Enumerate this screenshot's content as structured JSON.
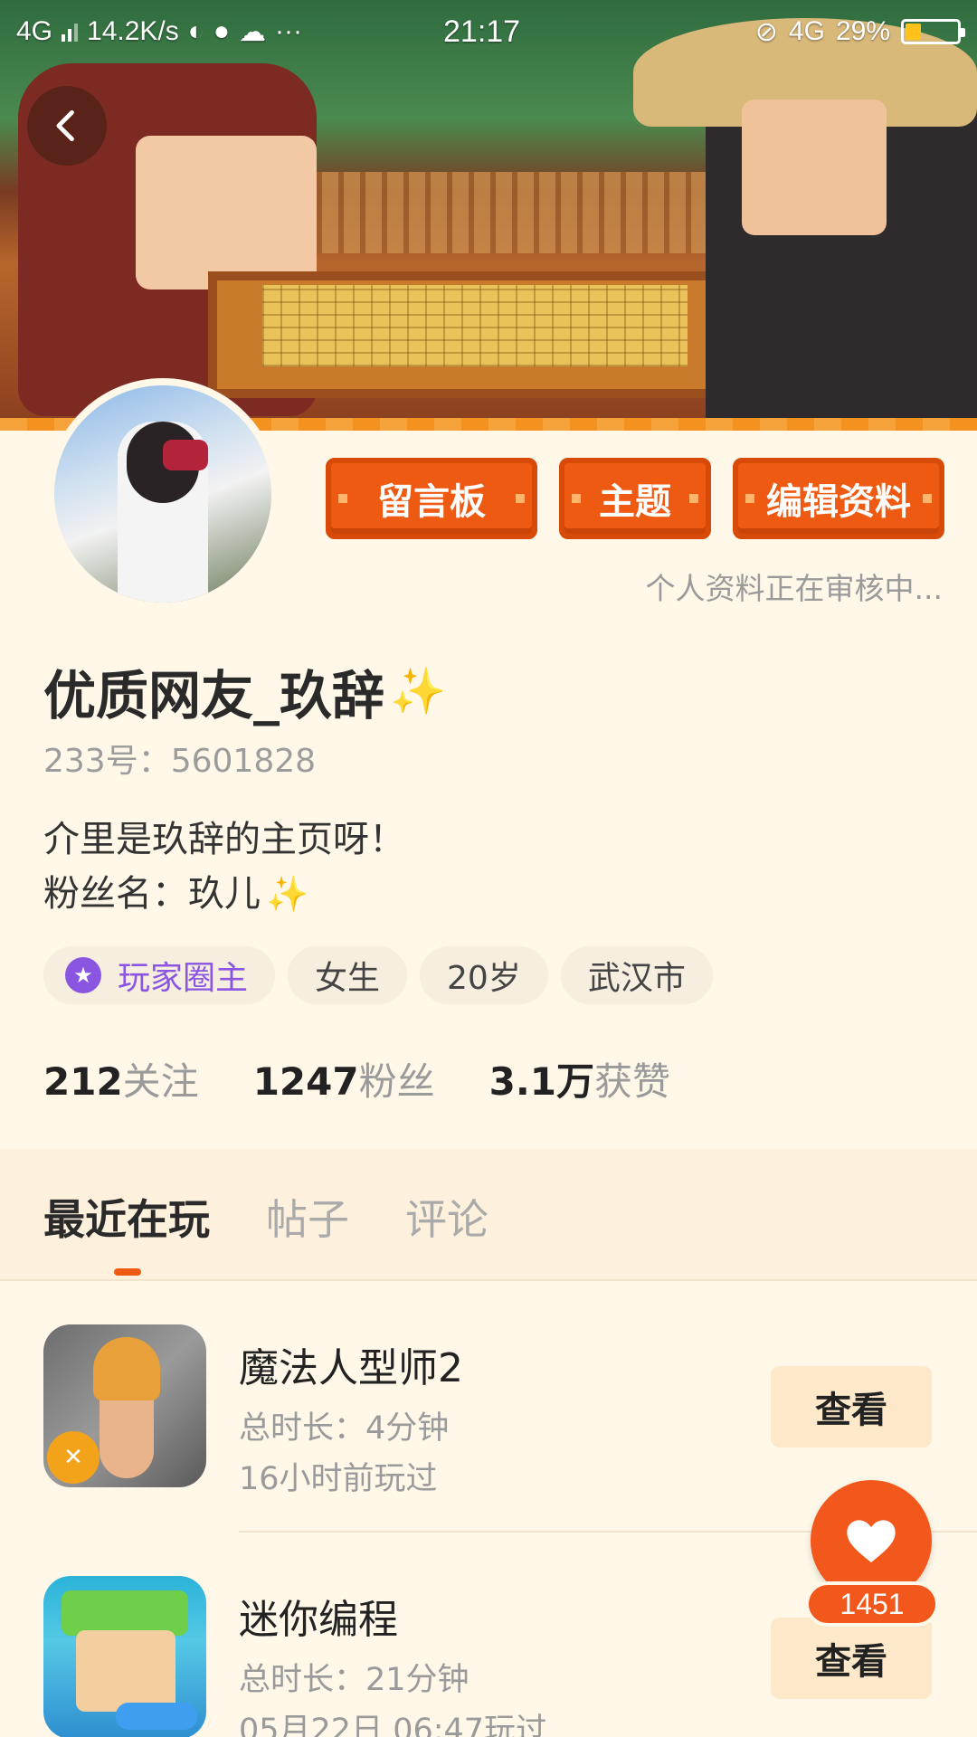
{
  "status_bar": {
    "network_left": "4G",
    "speed": "14.2K/s",
    "more": "···",
    "time": "21:17",
    "network_right": "4G",
    "battery": "29%",
    "battery_level": 0.29
  },
  "profile": {
    "buttons": {
      "message_board": "留言板",
      "theme": "主题",
      "edit_profile": "编辑资料"
    },
    "review_note": "个人资料正在审核中...",
    "name": "优质网友_玖辞",
    "name_emoji": "✨",
    "uid": "233号：5601828",
    "bio_line1": "介里是玖辞的主页呀！",
    "bio_line2": "粉丝名：玖儿",
    "bio_emoji": "✨",
    "tags": {
      "role": "玩家圈主",
      "gender": "女生",
      "age": "20岁",
      "city": "武汉市"
    },
    "stats": {
      "following_value": "212",
      "following_label": "关注",
      "fans_value": "1247",
      "fans_label": "粉丝",
      "likes_value": "3.1万",
      "likes_label": "获赞"
    }
  },
  "tabs": {
    "recent": "最近在玩",
    "posts": "帖子",
    "comments": "评论"
  },
  "games": [
    {
      "title": "魔法人型师2",
      "duration": "总时长：4分钟",
      "last_played": "16小时前玩过",
      "button": "查看"
    },
    {
      "title": "迷你编程",
      "duration": "总时长：21分钟",
      "last_played": "05月22日 06:47玩过",
      "button": "查看"
    }
  ],
  "like_fab": {
    "count": "1451"
  },
  "colors": {
    "accent": "#ef5a12",
    "background": "#fff7e8",
    "role_purple": "#8a55e0"
  }
}
